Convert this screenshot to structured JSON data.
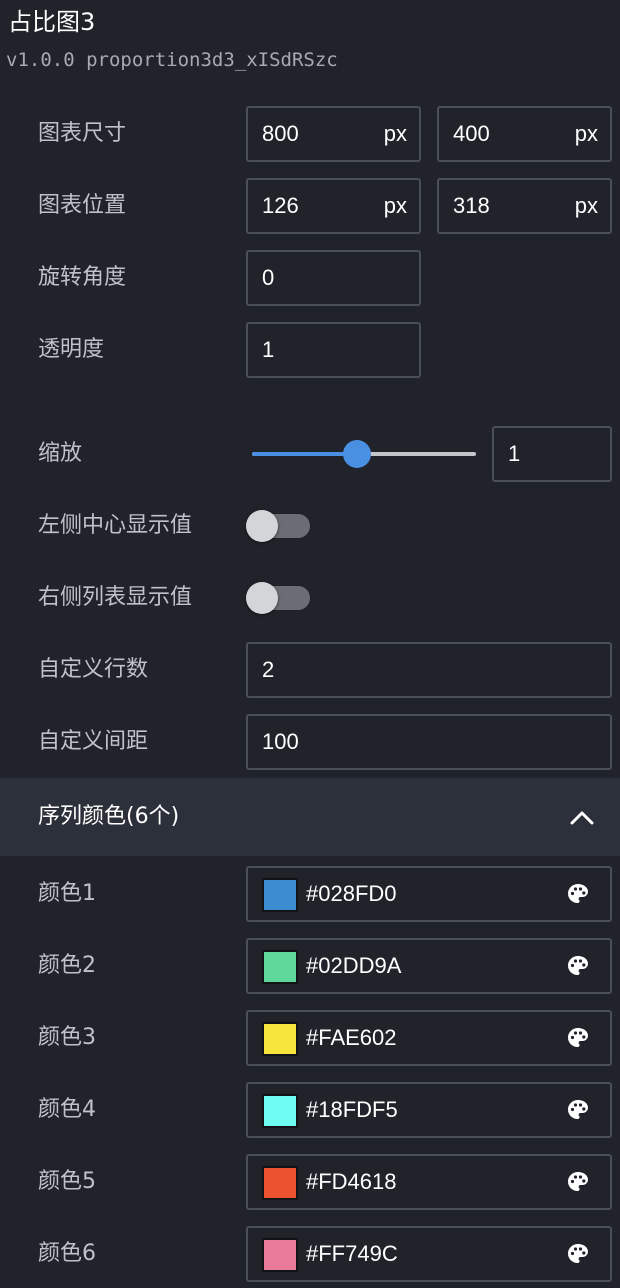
{
  "header": {
    "title": "占比图3",
    "subtitle": "v1.0.0 proportion3d3_xISdRSzc"
  },
  "props": {
    "size": {
      "label": "图表尺寸",
      "width": "800",
      "height": "400",
      "unit": "px"
    },
    "position": {
      "label": "图表位置",
      "x": "126",
      "y": "318",
      "unit": "px"
    },
    "rotation": {
      "label": "旋转角度",
      "value": "0"
    },
    "opacity": {
      "label": "透明度",
      "value": "1"
    },
    "scale": {
      "label": "缩放",
      "value": "1",
      "slider_fraction": 0.47
    },
    "left_center_value": {
      "label": "左侧中心显示值",
      "enabled": false
    },
    "right_list_value": {
      "label": "右侧列表显示值",
      "enabled": false
    },
    "custom_rows": {
      "label": "自定义行数",
      "value": "2"
    },
    "custom_spacing": {
      "label": "自定义间距",
      "value": "100"
    }
  },
  "series_colors": {
    "title": "序列颜色(6个)",
    "expanded": true,
    "items": [
      {
        "label": "颜色1",
        "hex": "#028FD0",
        "swatch": "#3d8bd0"
      },
      {
        "label": "颜色2",
        "hex": "#02DD9A",
        "swatch": "#5ed99b"
      },
      {
        "label": "颜色3",
        "hex": "#FAE602",
        "swatch": "#f7e43c"
      },
      {
        "label": "颜色4",
        "hex": "#18FDF5",
        "swatch": "#6ffdf3"
      },
      {
        "label": "颜色5",
        "hex": "#FD4618",
        "swatch": "#ea5230"
      },
      {
        "label": "颜色6",
        "hex": "#FF749C",
        "swatch": "#ea7a99"
      }
    ]
  },
  "icons": {
    "collapse": "chevron-up-icon",
    "color_picker": "palette-icon"
  },
  "theme": {
    "accent": "#4a90e2",
    "background": "#20232a",
    "section_bg": "#2c303a"
  }
}
